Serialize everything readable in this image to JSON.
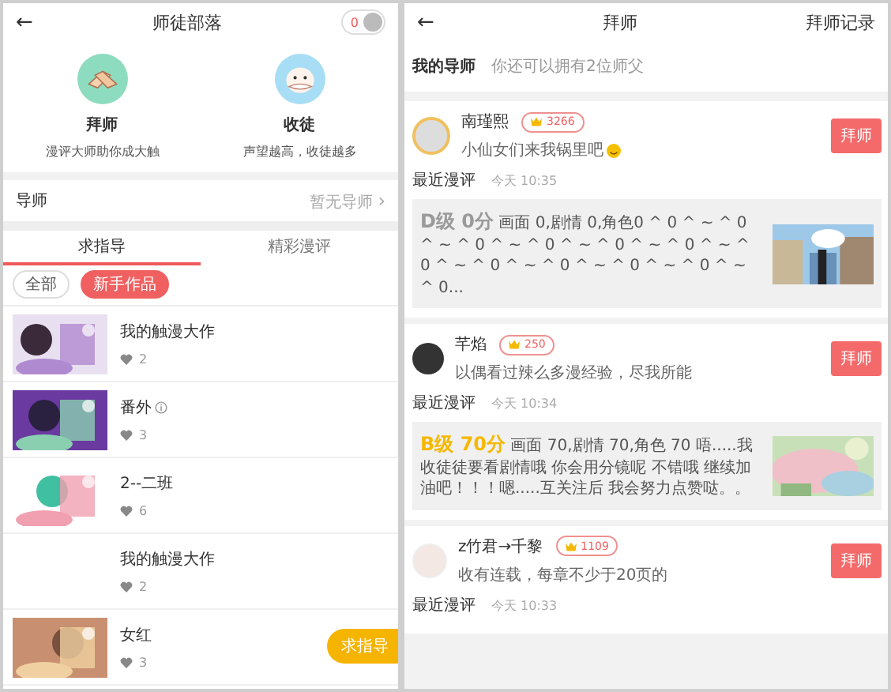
{
  "left": {
    "header": {
      "back": "←",
      "title": "师徒部落",
      "toggle_count": "0"
    },
    "features": [
      {
        "kind": "handshake",
        "title": "拜师",
        "subtitle": "漫评大师助你成大触"
      },
      {
        "kind": "seal",
        "title": "收徒",
        "subtitle": "声望越高，收徒越多"
      }
    ],
    "mentor_row": {
      "label": "导师",
      "value": "暂无导师",
      "chevron": "›"
    },
    "tabs": [
      {
        "label": "求指导",
        "selected": true
      },
      {
        "label": "精彩漫评",
        "selected": false
      }
    ],
    "chips": [
      {
        "label": "全部",
        "selected": false
      },
      {
        "label": "新手作品",
        "selected": true
      }
    ],
    "works": [
      {
        "kind": "picture",
        "title": "我的触漫大作",
        "info_icon": false,
        "likes": "2"
      },
      {
        "kind": "picture",
        "title": "番外",
        "info_icon": true,
        "likes": "3"
      },
      {
        "kind": "picture",
        "title": "2--二班",
        "info_icon": false,
        "likes": "6"
      },
      {
        "kind": "blank",
        "title": "我的触漫大作",
        "info_icon": false,
        "likes": "2"
      },
      {
        "kind": "picture",
        "title": "女红",
        "info_icon": false,
        "likes": "3"
      }
    ],
    "floating_button": "求指导"
  },
  "right": {
    "header": {
      "back": "←",
      "title": "拜师",
      "action": "拜师记录"
    },
    "my_mentor": {
      "label": "我的导师",
      "hint": "你还可以拥有2位师父"
    },
    "mentors": [
      {
        "name": "南瑾熙",
        "score": "3266",
        "motto": "小仙女们来我锅里吧",
        "emoji": true,
        "button": "拜师",
        "review_label": "最近漫评",
        "review_time": "今天 10:35",
        "review": {
          "grade": "D级 0分",
          "color": "#9a9a9a",
          "text": "画面 0,剧情 0,角色0 ^ 0 ^ ~ ^ 0 ^ ~ ^ 0 ^ ~ ^ 0 ^ ~ ^ 0 ^ ~ ^ 0 ^ ~ ^ 0 ^ ~ ^ 0 ^ ~ ^ 0 ^ ~ ^ 0 ^ ~ ^ 0 ^ ~ ^ 0..."
        }
      },
      {
        "name": "芊焰",
        "score": "250",
        "motto": "以偶看过辣么多漫经验，尽我所能",
        "emoji": false,
        "button": "拜师",
        "review_label": "最近漫评",
        "review_time": "今天 10:34",
        "review": {
          "grade": "B级 70分",
          "color": "#f5b800",
          "text": "画面 70,剧情 70,角色 70  唔.....我收徒徒要看剧情哦 你会用分镜呢 不错哦 继续加油吧！！！嗯.....互关注后 我会努力点赞哒。。"
        }
      },
      {
        "name": "z竹君→千黎",
        "score": "1109",
        "motto": "收有连载，每章不少于20页的",
        "emoji": false,
        "button": "拜师",
        "review_label": "最近漫评",
        "review_time": "今天 10:33"
      }
    ]
  }
}
